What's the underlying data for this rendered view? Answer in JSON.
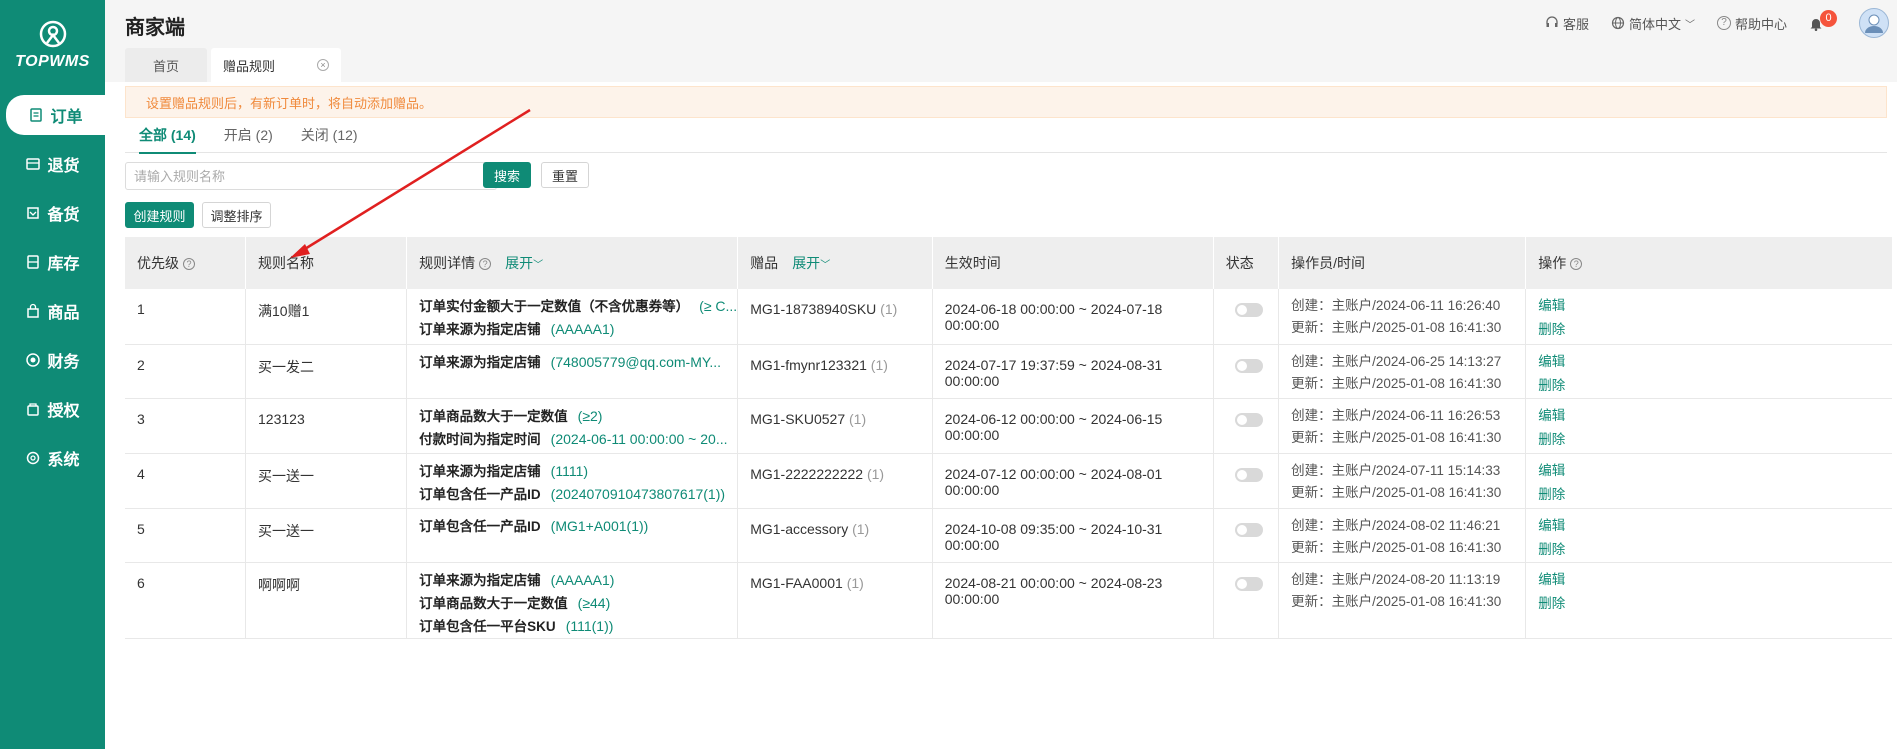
{
  "brand": {
    "name": "TOPWMS"
  },
  "sidebar": {
    "items": [
      {
        "label": "订单",
        "icon": "order-icon",
        "active": true
      },
      {
        "label": "退货",
        "icon": "return-icon",
        "active": false
      },
      {
        "label": "备货",
        "icon": "stock-prep-icon",
        "active": false
      },
      {
        "label": "库存",
        "icon": "inventory-icon",
        "active": false
      },
      {
        "label": "商品",
        "icon": "product-icon",
        "active": false
      },
      {
        "label": "财务",
        "icon": "finance-icon",
        "active": false
      },
      {
        "label": "授权",
        "icon": "auth-icon",
        "active": false
      },
      {
        "label": "系统",
        "icon": "system-icon",
        "active": false
      }
    ]
  },
  "header": {
    "title": "商家端",
    "tabs": [
      {
        "label": "首页"
      },
      {
        "label": "赠品规则"
      }
    ],
    "customer_service": "客服",
    "language": "简体中文",
    "help": "帮助中心",
    "notification_count": "0"
  },
  "notice": "设置赠品规则后，有新订单时，将自动添加赠品。",
  "status_tabs": [
    {
      "label": "全部 (14)"
    },
    {
      "label": "开启 (2)"
    },
    {
      "label": "关闭 (12)"
    }
  ],
  "search": {
    "placeholder": "请输入规则名称",
    "search_label": "搜索",
    "reset_label": "重置"
  },
  "actions": {
    "create_label": "创建规则",
    "sort_label": "调整排序"
  },
  "table": {
    "headers": {
      "priority": "优先级",
      "name": "规则名称",
      "details": "规则详情",
      "details_expand": "展开",
      "gift": "赠品",
      "gift_expand": "展开",
      "validity": "生效时间",
      "status": "状态",
      "operator": "操作员/时间",
      "ops": "操作"
    },
    "rows": [
      {
        "priority": "1",
        "name": "满10赠1",
        "conditions": [
          {
            "label": "订单实付金额大于一定数值（不含优惠券等）",
            "value": "(≥ C..."
          },
          {
            "label": "订单来源为指定店铺",
            "value": "(AAAAA1)"
          }
        ],
        "gift": "MG1-18738940SKU",
        "gift_count": "(1)",
        "validity": "2024-06-18 00:00:00 ~ 2024-07-18 00:00:00",
        "created": "创建：主账户/2024-06-11 16:26:40",
        "updated": "更新：主账户/2025-01-08 16:41:30"
      },
      {
        "priority": "2",
        "name": "买一发二",
        "conditions": [
          {
            "label": "订单来源为指定店铺",
            "value": "(748005779@qq.com-MY..."
          }
        ],
        "gift": "MG1-fmynr123321",
        "gift_count": "(1)",
        "validity": "2024-07-17 19:37:59 ~ 2024-08-31 00:00:00",
        "created": "创建：主账户/2024-06-25 14:13:27",
        "updated": "更新：主账户/2025-01-08 16:41:30"
      },
      {
        "priority": "3",
        "name": "123123",
        "conditions": [
          {
            "label": "订单商品数大于一定数值",
            "value": "(≥2)"
          },
          {
            "label": "付款时间为指定时间",
            "value": "(2024-06-11 00:00:00 ~ 20..."
          }
        ],
        "gift": "MG1-SKU0527",
        "gift_count": "(1)",
        "validity": "2024-06-12 00:00:00 ~ 2024-06-15 00:00:00",
        "created": "创建：主账户/2024-06-11 16:26:53",
        "updated": "更新：主账户/2025-01-08 16:41:30"
      },
      {
        "priority": "4",
        "name": "买一送一",
        "conditions": [
          {
            "label": "订单来源为指定店铺",
            "value": "(1111)"
          },
          {
            "label": "订单包含任一产品ID",
            "value": "(2024070910473807617(1))"
          }
        ],
        "gift": "MG1-2222222222",
        "gift_count": "(1)",
        "validity": "2024-07-12 00:00:00 ~ 2024-08-01 00:00:00",
        "created": "创建：主账户/2024-07-11 15:14:33",
        "updated": "更新：主账户/2025-01-08 16:41:30"
      },
      {
        "priority": "5",
        "name": "买一送一",
        "conditions": [
          {
            "label": "订单包含任一产品ID",
            "value": "(MG1+A001(1))"
          }
        ],
        "gift": "MG1-accessory",
        "gift_count": "(1)",
        "validity": "2024-10-08 09:35:00 ~ 2024-10-31 00:00:00",
        "created": "创建：主账户/2024-08-02 11:46:21",
        "updated": "更新：主账户/2025-01-08 16:41:30"
      },
      {
        "priority": "6",
        "name": "啊啊啊",
        "conditions": [
          {
            "label": "订单来源为指定店铺",
            "value": "(AAAAA1)"
          },
          {
            "label": "订单商品数大于一定数值",
            "value": "(≥44)"
          },
          {
            "label": "订单包含任一平台SKU",
            "value": "(111(1))"
          }
        ],
        "gift": "MG1-FAA0001",
        "gift_count": "(1)",
        "validity": "2024-08-21 00:00:00 ~ 2024-08-23 00:00:00",
        "created": "创建：主账户/2024-08-20 11:13:19",
        "updated": "更新：主账户/2025-01-08 16:41:30"
      }
    ],
    "edit_label": "编辑",
    "delete_label": "删除"
  },
  "colors": {
    "brand": "#0f8b76",
    "notice_text": "#f08a3c",
    "annotation_arrow": "#e02020"
  }
}
